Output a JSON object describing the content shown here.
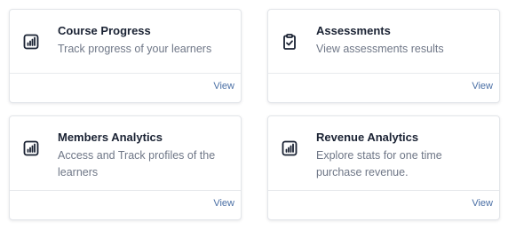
{
  "cards": [
    {
      "title": "Course Progress",
      "description": "Track progress of your learners",
      "icon": "bar-chart-icon",
      "view_label": "View"
    },
    {
      "title": "Assessments",
      "description": "View assessments results",
      "icon": "clipboard-check-icon",
      "view_label": "View"
    },
    {
      "title": "Members Analytics",
      "description": "Access and Track profiles of the learners",
      "icon": "bar-chart-icon",
      "view_label": "View"
    },
    {
      "title": "Revenue Analytics",
      "description": "Explore stats for one time purchase revenue.",
      "icon": "bar-chart-icon",
      "view_label": "View"
    }
  ],
  "colors": {
    "title": "#1a2233",
    "description": "#6f7787",
    "link": "#4a6fa5",
    "border": "#e3e6ea"
  }
}
